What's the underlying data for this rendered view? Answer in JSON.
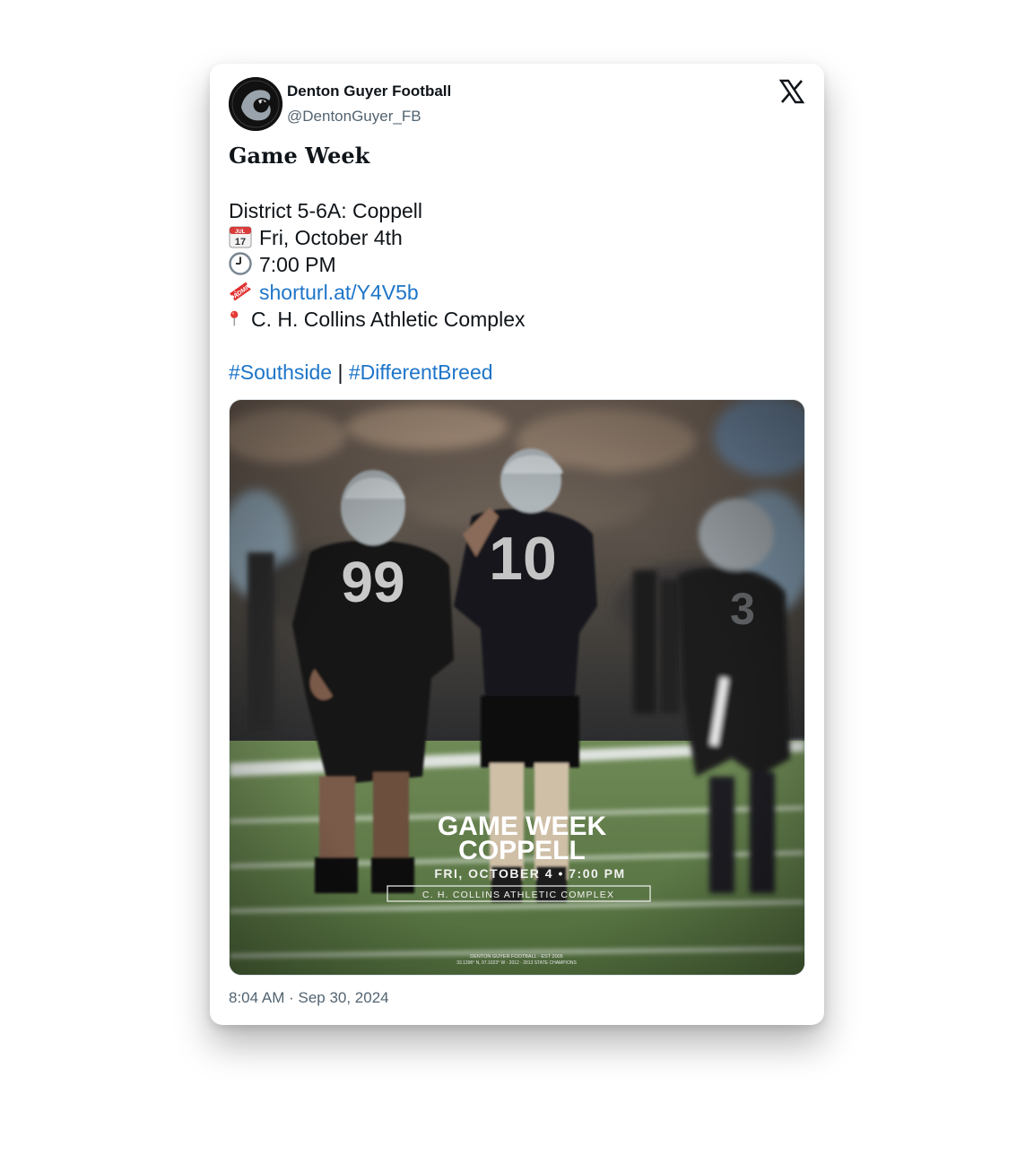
{
  "author": {
    "name": "Denton Guyer Football",
    "handle": "@DentonGuyer_FB"
  },
  "platform_icon": "x-logo-icon",
  "post": {
    "headline": "Game Week",
    "district": "District 5-6A: Coppell",
    "date_icon": "calendar-icon",
    "calendar_month": "JUL",
    "calendar_day": "17",
    "date": "Fri, October 4th",
    "time_icon": "clock-icon",
    "time": "7:00 PM",
    "ticket_icon": "ticket-icon",
    "ticket_link": "shorturl.at/Y4V5b",
    "location_icon": "pin-icon",
    "location": "C. H. Collins Athletic Complex",
    "hashtag_1": "#Southside",
    "separator": "|",
    "hashtag_2": "#DifferentBreed"
  },
  "graphic": {
    "title_line_1": "GAME WEEK",
    "title_line_2": "COPPELL",
    "datetime": "FRI, OCTOBER 4 • 7:00 PM",
    "venue": "C. H. COLLINS ATHLETIC COMPLEX",
    "jersey_1": "99",
    "jersey_2": "10",
    "jersey_3": "3",
    "footer_1": "DENTON GUYER FOOTBALL · EST 2005",
    "footer_2": "33.1396° N, 97.1023° W · 2012 · 2013 STATE CHAMPIONS"
  },
  "timestamp": "8:04 AM · Sep 30, 2024",
  "colors": {
    "link": "#1d75c9",
    "text": "#0f1419",
    "muted": "#536471"
  }
}
